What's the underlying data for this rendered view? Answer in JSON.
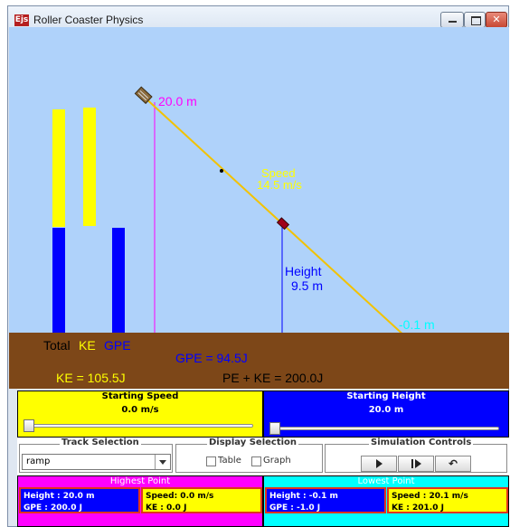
{
  "window": {
    "title": "Roller Coaster Physics",
    "icon_text": "Ejs"
  },
  "simulation": {
    "start_label": "20.0 m",
    "end_label": "-0.1 m",
    "speed_label": "Speed",
    "speed_value": "14.5 m/s",
    "height_label": "Height",
    "height_value": "9.5 m",
    "total_label": "Total",
    "ke_label": "KE",
    "gpe_label": "GPE",
    "gpe_readout": "GPE = 94.5J",
    "ke_readout": "KE = 105.5J",
    "total_readout": "PE + KE = 200.0J",
    "ke_total_fraction": 0.65,
    "gpe_total_fraction": 0.58,
    "ke_fraction": 0.49,
    "gpe_fraction": 0.58
  },
  "starting_speed": {
    "title": "Starting Speed",
    "value": "0.0 m/s",
    "slider_fraction": 0.0
  },
  "starting_height": {
    "title": "Starting Height",
    "value": "20.0 m",
    "slider_fraction": 0.0
  },
  "track_selection": {
    "title": "Track Selection",
    "value": "ramp"
  },
  "display_selection": {
    "title": "Display Selection",
    "table_label": "Table",
    "graph_label": "Graph"
  },
  "simulation_controls": {
    "title": "Simulation Controls"
  },
  "highest_point": {
    "title": "Highest Point",
    "height": "Height : 20.0 m",
    "gpe": "GPE : 200.0 J",
    "speed": "Speed: 0.0 m/s",
    "ke": "KE : 0.0 J"
  },
  "lowest_point": {
    "title": "Lowest Point",
    "height": "Height : -0.1 m",
    "gpe": "GPE : -1.0 J",
    "speed": "Speed : 20.1 m/s",
    "ke": "KE : 201.0 J"
  },
  "colors": {
    "sky": "#afd2fa",
    "ground": "#7d4718",
    "ke": "#ffff00",
    "gpe": "#0000ff",
    "track": "#f2c200",
    "magenta": "#ff00ff",
    "cyan": "#00ffff"
  }
}
